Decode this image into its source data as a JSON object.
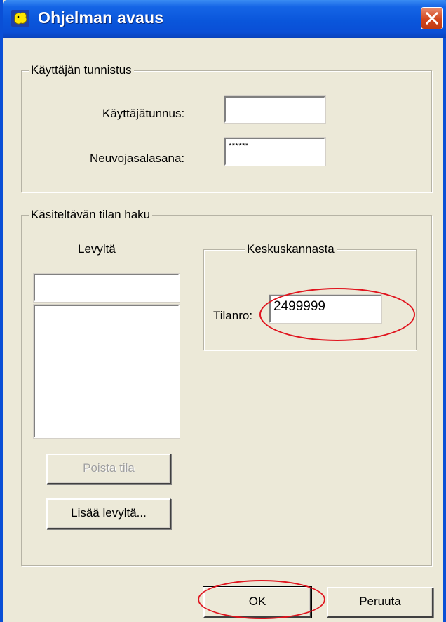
{
  "window": {
    "title": "Ohjelman avaus",
    "icon": "yellow-blob-icon",
    "accent": "#0a4fd6",
    "face": "#ece9d8"
  },
  "user_group": {
    "legend": "Käyttäjän tunnistus",
    "username_label": "Käyttäjätunnus:",
    "username_value": "",
    "password_label": "Neuvojasalasana:",
    "password_value": "******"
  },
  "farm_group": {
    "legend": "Käsiteltävän tilan haku",
    "disk_label": "Levyltä",
    "disk_input_value": "",
    "remove_button": "Poista tila",
    "add_button": "Lisää levyltä...",
    "central_group": {
      "legend": "Keskuskannasta",
      "farm_no_label": "Tilanro:",
      "farm_no_value": "2499999"
    }
  },
  "footer": {
    "ok_label": "OK",
    "cancel_label": "Peruuta"
  },
  "highlight_color": "#e0141e"
}
